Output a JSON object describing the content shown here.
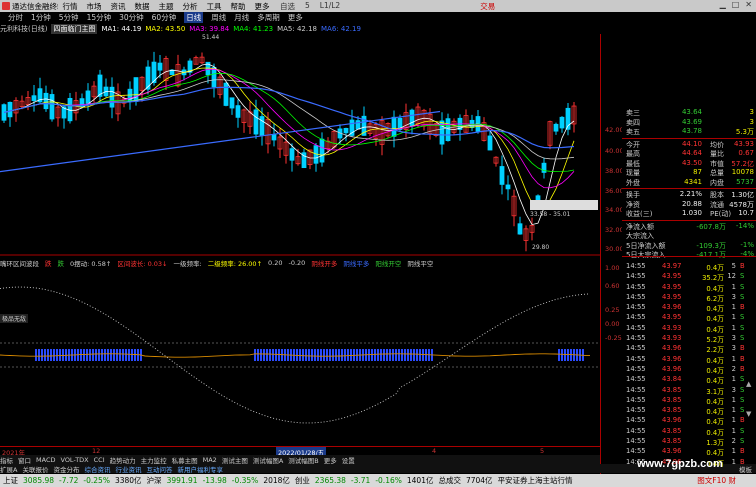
{
  "app": {
    "title": "通达信金融终端",
    "trade_label": "交易"
  },
  "menu": [
    "行情",
    "市场",
    "资讯",
    "数据",
    "主题",
    "分析",
    "工具",
    "帮助",
    "更多"
  ],
  "menu_extras": [
    "自选",
    "5"
  ],
  "menu_tail": "L1/L2",
  "periods": [
    "分时",
    "1分钟",
    "5分钟",
    "15分钟",
    "30分钟",
    "60分钟",
    "日线",
    "周线",
    "月线",
    "多周期",
    "更多"
  ],
  "active_period": "日线",
  "stock": {
    "name": "元利科技(日线)",
    "tag": "四面临门主图"
  },
  "ma_legend": [
    {
      "label": "MA1: 44.19",
      "color": "#ffffff"
    },
    {
      "label": "MA2: 43.50",
      "color": "#ffff00"
    },
    {
      "label": "MA3: 39.84",
      "color": "#ff00ff"
    },
    {
      "label": "MA4: 41.23",
      "color": "#00ff00"
    },
    {
      "label": "MA5: 42.18",
      "color": "#cccccc"
    },
    {
      "label": "MA6: 42.19",
      "color": "#3a6bff"
    }
  ],
  "price_axis": [
    "42.00",
    "40.00",
    "38.00",
    "36.00",
    "34.00",
    "32.00",
    "30.00"
  ],
  "annotations": {
    "high": "51.44",
    "low": "29.80",
    "range": "33.58 - 35.01"
  },
  "sub_header": {
    "name": "嘴环区间波段",
    "items": [
      {
        "text": "跌",
        "color": "#ff3333"
      },
      {
        "text": "跌",
        "color": "#33cc33"
      },
      {
        "text": "0摆动: 0.58↑",
        "color": "#cccccc"
      },
      {
        "text": "区间波长: 0.03↓",
        "color": "#ff3333"
      },
      {
        "text": "一级频率: ",
        "color": "#cccccc"
      },
      {
        "text": "二级频率: 26.00↑",
        "color": "#ffff00"
      },
      {
        "text": "0.20",
        "color": "#cccccc"
      },
      {
        "text": "-0.20",
        "color": "#cccccc"
      },
      {
        "text": "阴线开多",
        "color": "#ff3333"
      },
      {
        "text": "阴线平多",
        "color": "#3a6bff"
      },
      {
        "text": "阳线开空",
        "color": "#33cc33"
      },
      {
        "text": "阴线平空",
        "color": "#cccccc"
      }
    ]
  },
  "sub_axis": [
    "1.00",
    "0.60",
    "0.25",
    "0.00",
    "-0.25"
  ],
  "sub_tag": "极品无敌",
  "time_axis": [
    {
      "label": "2021年"
    },
    {
      "label": "12"
    },
    {
      "label": "2022/01/28/五"
    },
    {
      "label": "4"
    },
    {
      "label": "5"
    }
  ],
  "tabs1": [
    "指标",
    "窗口",
    "MACD",
    "VOL-TDX",
    "CCI",
    "趋势动力",
    "主力监控",
    "私募主图",
    "MA2",
    "测试主图",
    "测试幅图A",
    "测试幅图B",
    "更多",
    "设置"
  ],
  "tabs2": [
    "扩展A",
    "关联报价",
    "资金分布",
    "综合资讯",
    "行业资讯",
    "互动问答",
    "新用户福利专享"
  ],
  "tabs2_trailing": "模板",
  "quote": {
    "asks": [
      {
        "label": "卖三",
        "price": "43.64",
        "vol": "3"
      },
      {
        "label": "卖四",
        "price": "43.69",
        "vol": "3"
      },
      {
        "label": "卖五",
        "price": "43.78",
        "vol": "5.3万"
      }
    ],
    "stats": [
      {
        "l1": "今开",
        "v1": "44.10",
        "l2": "均价",
        "v2": "43.93"
      },
      {
        "l1": "最高",
        "v1": "44.64",
        "l2": "量比",
        "v2": "0.67"
      },
      {
        "l1": "最低",
        "v1": "43.50",
        "l2": "市值",
        "v2": "57.2亿"
      },
      {
        "l1": "现量",
        "v1": "87",
        "l2": "总量",
        "v2": "10078"
      },
      {
        "l1": "外盘",
        "v1": "4341",
        "l2": "内盘",
        "v2": "5737"
      }
    ],
    "stats2": [
      {
        "l1": "换手",
        "v1": "2.21%",
        "l2": "股本",
        "v2": "1.30亿"
      },
      {
        "l1": "净资",
        "v1": "20.88",
        "l2": "流通",
        "v2": "4578万"
      },
      {
        "l1": "收益(三)",
        "v1": "1.030",
        "l2": "PE(动)",
        "v2": "10.7"
      }
    ],
    "flows": [
      {
        "label": "净流入额",
        "value": "-607.8万",
        "pct": "-14%"
      },
      {
        "label": "大宗流入",
        "value": "",
        "pct": ""
      },
      {
        "label": "5日净流入额",
        "value": "-109.3万",
        "pct": "-1%"
      },
      {
        "label": "5日大宗流入",
        "value": "-417.1万",
        "pct": "-4%"
      }
    ]
  },
  "ticks": [
    {
      "t": "14:55",
      "p": "43.97",
      "vol": "0.4万",
      "n": "5",
      "bs": "B"
    },
    {
      "t": "14:55",
      "p": "43.95",
      "vol": "35.2万",
      "n": "12",
      "bs": "S"
    },
    {
      "t": "14:55",
      "p": "43.95",
      "vol": "0.4万",
      "n": "1",
      "bs": "S"
    },
    {
      "t": "14:55",
      "p": "43.95",
      "vol": "6.2万",
      "n": "3",
      "bs": "S"
    },
    {
      "t": "14:55",
      "p": "43.96",
      "vol": "0.4万",
      "n": "1",
      "bs": "B"
    },
    {
      "t": "14:55",
      "p": "43.95",
      "vol": "0.4万",
      "n": "1",
      "bs": "S"
    },
    {
      "t": "14:55",
      "p": "43.93",
      "vol": "0.4万",
      "n": "1",
      "bs": "S"
    },
    {
      "t": "14:55",
      "p": "43.93",
      "vol": "5.2万",
      "n": "3",
      "bs": "S"
    },
    {
      "t": "14:55",
      "p": "43.96",
      "vol": "2.2万",
      "n": "3",
      "bs": "B"
    },
    {
      "t": "14:55",
      "p": "43.96",
      "vol": "0.4万",
      "n": "1",
      "bs": "B"
    },
    {
      "t": "14:55",
      "p": "43.96",
      "vol": "0.4万",
      "n": "2",
      "bs": "B"
    },
    {
      "t": "14:55",
      "p": "43.84",
      "vol": "0.4万",
      "n": "1",
      "bs": "S"
    },
    {
      "t": "14:55",
      "p": "43.85",
      "vol": "3.1万",
      "n": "3",
      "bs": "S"
    },
    {
      "t": "14:55",
      "p": "43.85",
      "vol": "0.4万",
      "n": "1",
      "bs": "S"
    },
    {
      "t": "14:55",
      "p": "43.85",
      "vol": "0.4万",
      "n": "1",
      "bs": "S"
    },
    {
      "t": "14:55",
      "p": "43.96",
      "vol": "0.4万",
      "n": "1",
      "bs": "B"
    },
    {
      "t": "14:55",
      "p": "43.85",
      "vol": "0.4万",
      "n": "1",
      "bs": "S"
    },
    {
      "t": "14:55",
      "p": "43.85",
      "vol": "1.3万",
      "n": "2",
      "bs": "S"
    },
    {
      "t": "14:55",
      "p": "43.96",
      "vol": "0.4万",
      "n": "1",
      "bs": "B"
    },
    {
      "t": "14:55",
      "p": "43.96",
      "vol": "0.4万",
      "n": "1",
      "bs": "B"
    }
  ],
  "status": {
    "indices": [
      {
        "name": "上证",
        "value": "3085.98",
        "chg": "-7.72",
        "pct": "-0.25%",
        "amt": "3380亿"
      },
      {
        "name": "沪深",
        "value": "3991.91",
        "chg": "-13.98",
        "pct": "-0.35%",
        "amt": "2018亿"
      },
      {
        "name": "创业",
        "value": "2365.38",
        "chg": "-3.71",
        "pct": "-0.16%",
        "amt": "1401亿"
      }
    ],
    "total_label": "总成交",
    "total_value": "7704亿",
    "server": "平安证券上海主站行情",
    "fin": "图文F10 财"
  },
  "watermark": "www.7gpzb.com",
  "colors": {
    "up": "#ff3333",
    "down": "#33cc33",
    "candle_down": "#00d0ff",
    "axis": "#aa0000"
  }
}
